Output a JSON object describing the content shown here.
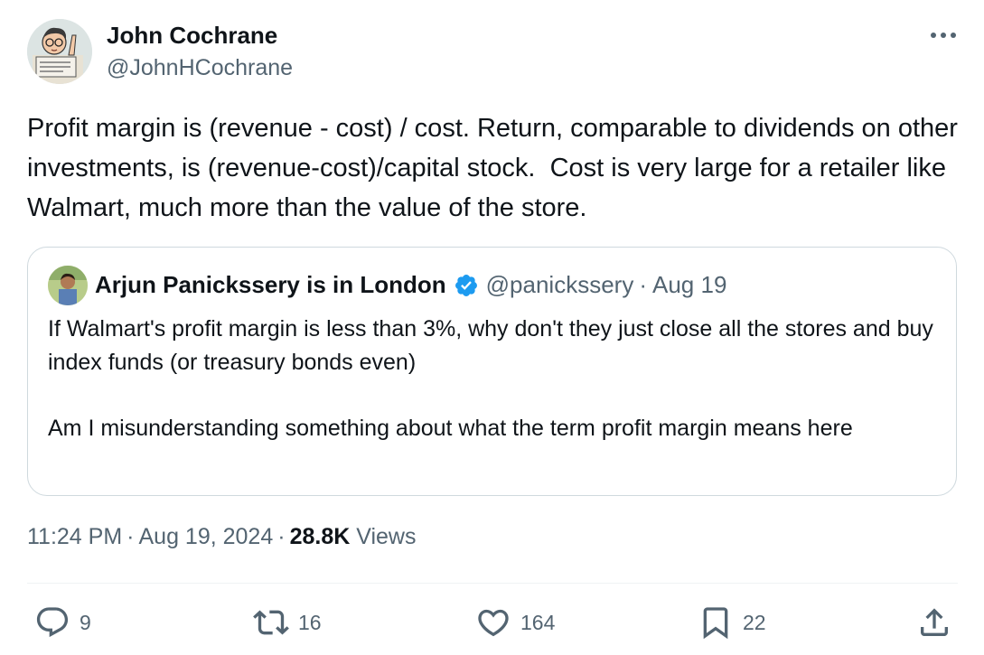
{
  "author": {
    "name": "John Cochrane",
    "handle": "@JohnHCochrane"
  },
  "tweet": {
    "text": "Profit margin is (revenue - cost) / cost. Return, comparable to dividends on other investments, is (revenue-cost)/capital stock.  Cost is very large for a retailer like Walmart, much more than the value of the store."
  },
  "quote": {
    "name": "Arjun Panickssery is in London",
    "handle": "@panickssery",
    "separator": "·",
    "date": "Aug 19",
    "paragraphs": [
      "If Walmart's profit margin is less than 3%, why don't they just close all the stores and buy index funds (or treasury bonds even)",
      "Am I misunderstanding something about what the term profit margin means here"
    ]
  },
  "meta": {
    "time": "11:24 PM",
    "separator": "·",
    "date": "Aug 19, 2024",
    "views_count": "28.8K",
    "views_label": "Views"
  },
  "actions": {
    "replies": "9",
    "reposts": "16",
    "likes": "164",
    "bookmarks": "22"
  },
  "icons": {
    "more": "more-horizontal-icon",
    "verified": "verified-badge-icon",
    "reply": "reply-icon",
    "repost": "repost-icon",
    "like": "heart-icon",
    "bookmark": "bookmark-icon",
    "share": "share-icon"
  },
  "colors": {
    "text_primary": "#0f1419",
    "text_secondary": "#536471",
    "border": "#cfd9de",
    "verified_blue": "#1d9bf0"
  }
}
